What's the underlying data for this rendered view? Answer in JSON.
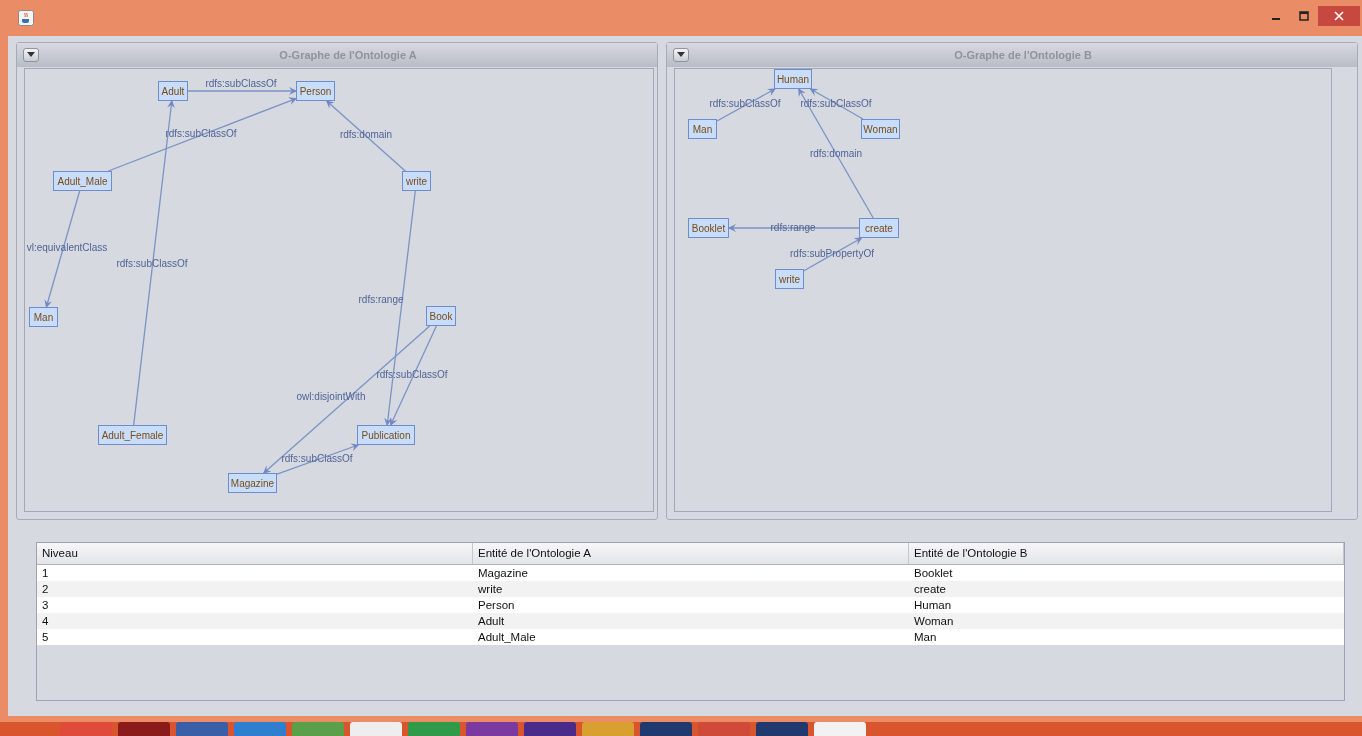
{
  "graphs": [
    {
      "title": "O-Graphe de l'Ontologie A",
      "nodes": [
        {
          "label": "Adult"
        },
        {
          "label": "Person"
        },
        {
          "label": "Adult_Male"
        },
        {
          "label": "write"
        },
        {
          "label": "Man"
        },
        {
          "label": "Book"
        },
        {
          "label": "Adult_Female"
        },
        {
          "label": "Publication"
        },
        {
          "label": "Magazine"
        }
      ],
      "edges": [
        {
          "label": "rdfs:subClassOf"
        },
        {
          "label": "rdfs:subClassOf"
        },
        {
          "label": "rdfs:domain"
        },
        {
          "label": "vl:equivalentClass"
        },
        {
          "label": "rdfs:subClassOf"
        },
        {
          "label": "rdfs:range"
        },
        {
          "label": "rdfs:subClassOf"
        },
        {
          "label": "owl:disjointWith"
        },
        {
          "label": "rdfs:subClassOf"
        }
      ]
    },
    {
      "title": "O-Graphe de l'Ontologie B",
      "nodes": [
        {
          "label": "Human"
        },
        {
          "label": "Man"
        },
        {
          "label": "Woman"
        },
        {
          "label": "Booklet"
        },
        {
          "label": "create"
        },
        {
          "label": "write"
        }
      ],
      "edges": [
        {
          "label": "rdfs:subClassOf"
        },
        {
          "label": "rdfs:subClassOf"
        },
        {
          "label": "rdfs:domain"
        },
        {
          "label": "rdfs:range"
        },
        {
          "label": "rdfs:subPropertyOf"
        }
      ]
    }
  ],
  "table": {
    "columns": [
      "Niveau",
      "Entité de l'Ontologie A",
      "Entité de l'Ontologie B"
    ],
    "rows": [
      [
        "1",
        "Magazine",
        "Booklet"
      ],
      [
        "2",
        "write",
        "create"
      ],
      [
        "3",
        "Person",
        "Human"
      ],
      [
        "4",
        "Adult",
        "Woman"
      ],
      [
        "5",
        "Adult_Male",
        "Man"
      ]
    ]
  }
}
